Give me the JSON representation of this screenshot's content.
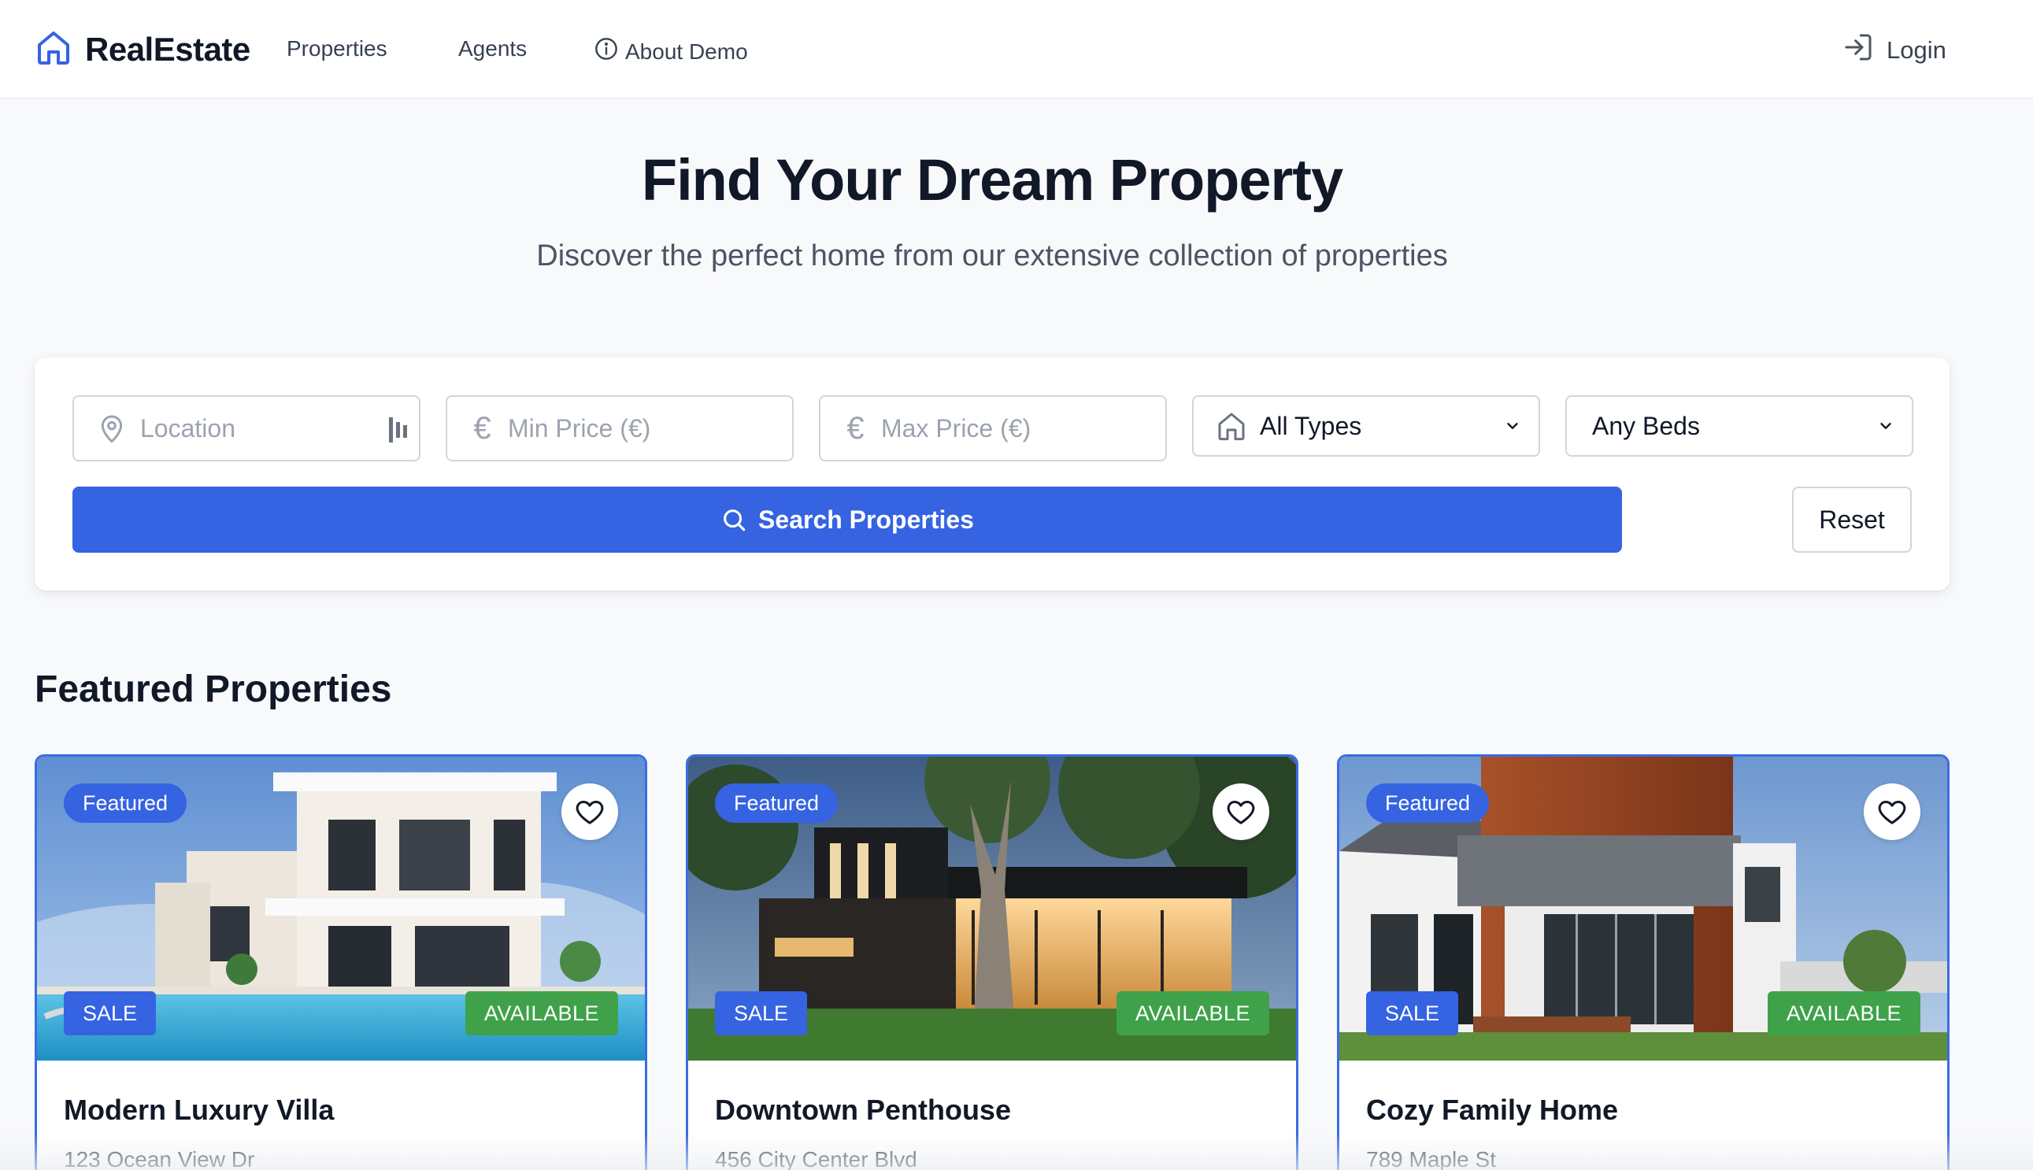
{
  "nav": {
    "brand": "RealEstate",
    "links": [
      {
        "label": "Properties"
      },
      {
        "label": "Agents"
      },
      {
        "label": "About Demo"
      }
    ],
    "login_label": "Login"
  },
  "hero": {
    "title": "Find Your Dream Property",
    "subtitle": "Discover the perfect home from our extensive collection of properties"
  },
  "search": {
    "location_placeholder": "Location",
    "min_price_placeholder": "Min Price (€)",
    "max_price_placeholder": "Max Price (€)",
    "currency_symbol": "€",
    "type_selected": "All Types",
    "beds_selected": "Any Beds",
    "search_label": "Search Properties",
    "reset_label": "Reset"
  },
  "featured": {
    "title": "Featured Properties",
    "properties": [
      {
        "featured_label": "Featured",
        "listing_type": "SALE",
        "status": "AVAILABLE",
        "title": "Modern Luxury Villa",
        "address": "123 Ocean View Dr"
      },
      {
        "featured_label": "Featured",
        "listing_type": "SALE",
        "status": "AVAILABLE",
        "title": "Downtown Penthouse",
        "address": "456 City Center Blvd"
      },
      {
        "featured_label": "Featured",
        "listing_type": "SALE",
        "status": "AVAILABLE",
        "title": "Cozy Family Home",
        "address": "789 Maple St"
      }
    ]
  },
  "colors": {
    "primary": "#3563e1",
    "available": "#3fa24a",
    "text": "#111827",
    "muted": "#4b5563"
  },
  "icons": {
    "brand": "house-icon",
    "about": "info-icon",
    "login": "login-icon",
    "location": "map-pin-icon",
    "type": "house-icon",
    "search": "search-icon",
    "favorite": "heart-icon"
  }
}
